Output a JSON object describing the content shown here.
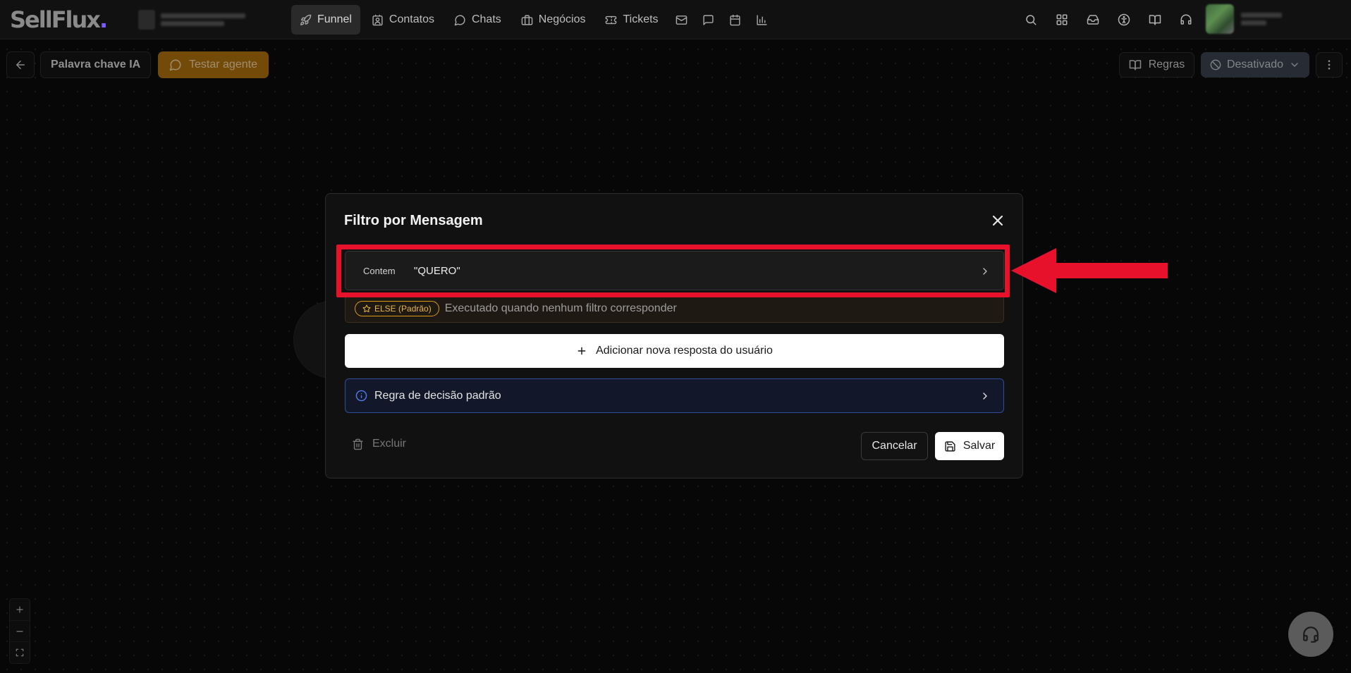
{
  "app": {
    "logo_text": "SellFlux",
    "logo_dot": "."
  },
  "nav": {
    "items": [
      {
        "label": "Funnel",
        "icon": "rocket-icon",
        "active": true
      },
      {
        "label": "Contatos",
        "icon": "contacts-icon"
      },
      {
        "label": "Chats",
        "icon": "chat-bubble-icon"
      },
      {
        "label": "Negócios",
        "icon": "briefcase-icon"
      },
      {
        "label": "Tickets",
        "icon": "ticket-icon"
      }
    ],
    "icon_buttons": [
      "mail-icon",
      "message-square-icon",
      "calendar-icon",
      "bar-chart-icon"
    ]
  },
  "toolbar_right": [
    "search-icon",
    "apps-grid-icon",
    "inbox-icon",
    "accessibility-icon",
    "book-icon",
    "headset-icon"
  ],
  "flow": {
    "name": "Palavra chave IA",
    "test_label": "Testar agente",
    "rules_label": "Regras",
    "status_label": "Desativado"
  },
  "modal": {
    "title": "Filtro por Mensagem",
    "filter": {
      "operator": "Contem",
      "value": "\"QUERO\""
    },
    "else_badge": "ELSE (Padrão)",
    "else_description": "Executado quando nenhum filtro corresponder",
    "add_label": "Adicionar nova resposta do usuário",
    "rule_label": "Regra de decisão padrão",
    "delete_label": "Excluir",
    "cancel_label": "Cancelar",
    "save_label": "Salvar"
  },
  "colors": {
    "highlight": "#e8112b",
    "test_button": "#b3720e",
    "status_button": "#3c4350",
    "else_badge": "#d79a1b",
    "rule_border": "#2f4d9a"
  }
}
